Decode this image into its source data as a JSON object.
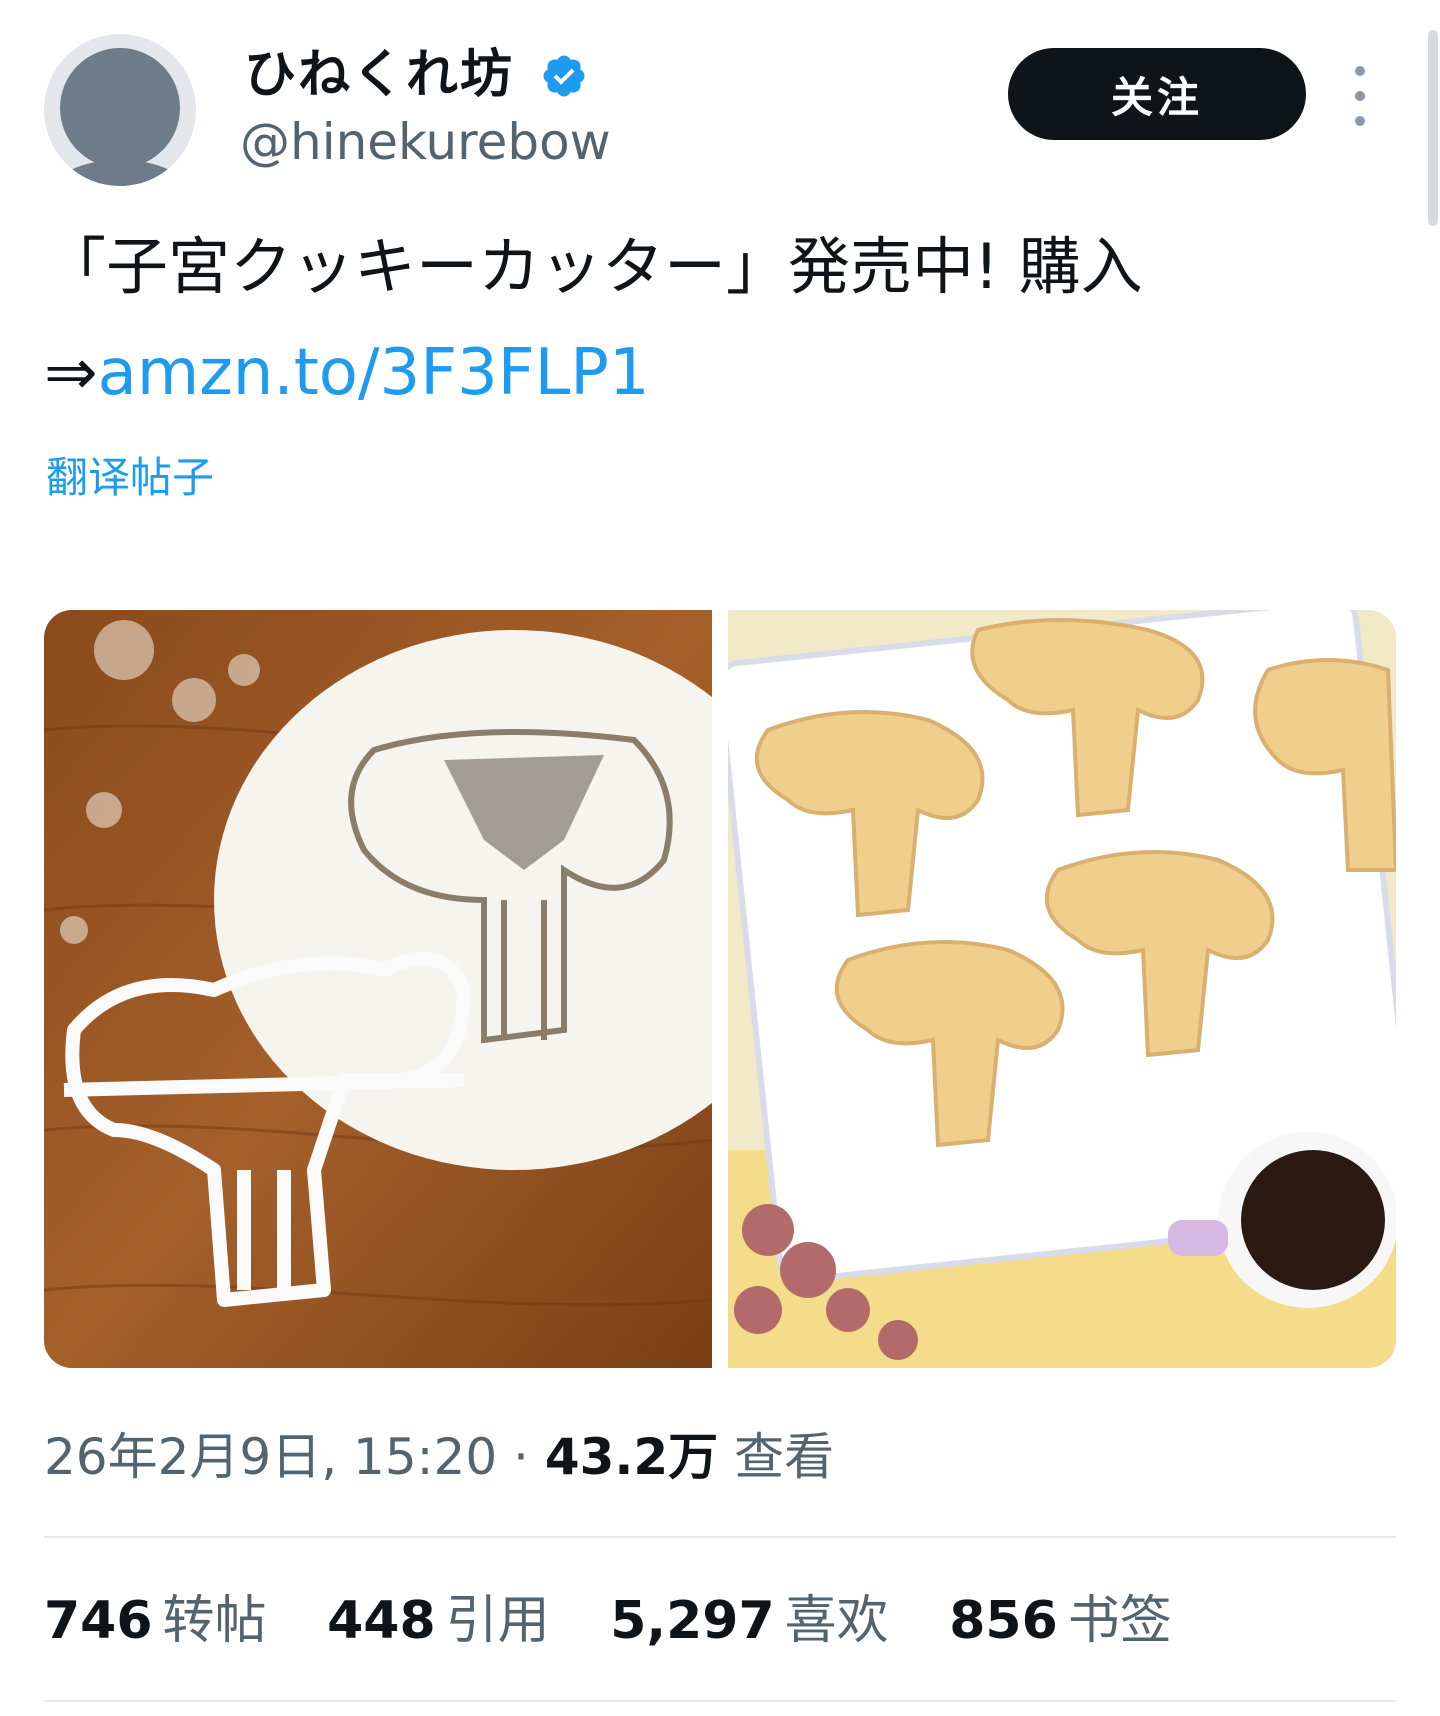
{
  "author": {
    "display_name": "ひねくれ坊",
    "handle": "@hinekurebow",
    "verified": true
  },
  "actions": {
    "follow_label": "关注"
  },
  "tweet": {
    "line1": "「子宮クッキーカッター」発売中! 購入",
    "arrow": "⇒",
    "link_text": "amzn.to/3F3FLP1",
    "translate_label": "翻译帖子"
  },
  "meta": {
    "datetime": "26年2月9日, 15:20",
    "separator": " · ",
    "views_count": "43.2万",
    "views_label": "查看"
  },
  "stats": {
    "retweets_count": "746",
    "retweets_label": "转帖",
    "quotes_count": "448",
    "quotes_label": "引用",
    "likes_count": "5,297",
    "likes_label": "喜欢",
    "bookmarks_count": "856",
    "bookmarks_label": "书签"
  },
  "colors": {
    "accent": "#1d9bf0",
    "text_primary": "#0f1419",
    "text_secondary": "#536471",
    "button_bg": "#0f1419"
  },
  "icons": {
    "verified": "verified-badge-icon",
    "more": "more-vertical-icon"
  }
}
